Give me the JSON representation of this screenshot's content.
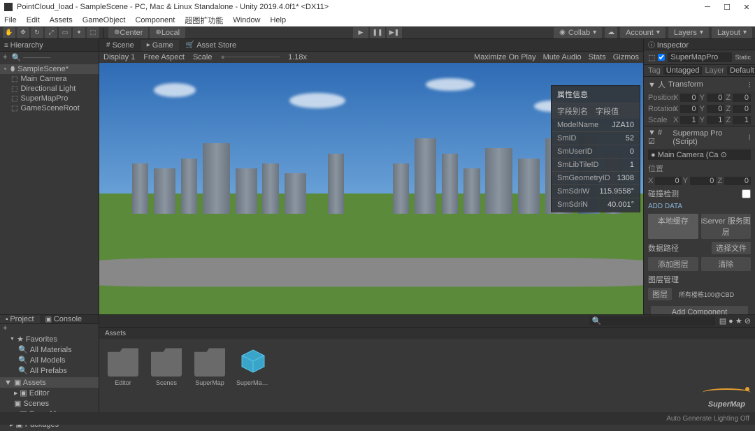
{
  "title": "PointCloud_load - SampleScene - PC, Mac & Linux Standalone - Unity 2019.4.0f1* <DX11>",
  "menu": [
    "File",
    "Edit",
    "Assets",
    "GameObject",
    "Component",
    "超图扩功能",
    "Window",
    "Help"
  ],
  "pivot": {
    "center": "Center",
    "local": "Local"
  },
  "toolbar_right": {
    "collab": "Collab",
    "account": "Account",
    "layers": "Layers",
    "layout": "Layout"
  },
  "hierarchy": {
    "tab": "Hierarchy",
    "create": "+",
    "scene": "SampleScene*",
    "items": [
      "Main Camera",
      "Directional Light",
      "SuperMapPro",
      "GameSceneRoot"
    ]
  },
  "gameview": {
    "tabs": {
      "scene": "Scene",
      "game": "Game",
      "asset_store": "Asset Store"
    },
    "display": "Display 1",
    "aspect": "Free Aspect",
    "scale_label": "Scale",
    "scale_value": "1.18x",
    "right_opts": [
      "Maximize On Play",
      "Mute Audio",
      "Stats",
      "Gizmos"
    ]
  },
  "attr": {
    "title": "属性信息",
    "col1": "字段别名",
    "col2": "字段值",
    "rows": [
      {
        "k": "ModelName",
        "v": "JZA10"
      },
      {
        "k": "SmID",
        "v": "52"
      },
      {
        "k": "SmUserID",
        "v": "0"
      },
      {
        "k": "SmLibTileID",
        "v": "1"
      },
      {
        "k": "SmGeometryID",
        "v": "1308"
      },
      {
        "k": "SmSdriW",
        "v": "115.9558°"
      },
      {
        "k": "SmSdriN",
        "v": "40.001°"
      }
    ]
  },
  "inspector": {
    "tab": "Inspector",
    "name": "SuperMapPro",
    "static": "Static",
    "tag_label": "Tag",
    "tag_value": "Untagged",
    "layer_label": "Layer",
    "layer_value": "Default",
    "transform": {
      "title": "Transform",
      "position": {
        "label": "Position",
        "x": "0",
        "y": "0",
        "z": "0"
      },
      "rotation": {
        "label": "Rotation",
        "x": "0",
        "y": "0",
        "z": "0"
      },
      "scale": {
        "label": "Scale",
        "x": "1",
        "y": "1",
        "z": "1"
      }
    },
    "script": {
      "title": "Supermap Pro (Script)",
      "main_camera": "Main Camera (Ca",
      "pos_label": "位置",
      "pos": {
        "x": "0",
        "y": "0",
        "z": "0"
      },
      "collision": "碰撞检测",
      "add_data": "ADD DATA",
      "tab1": "本地缓存",
      "tab2": "iServer 服务图层",
      "path_label": "数据路径",
      "browse": "选择文件",
      "add_layer": "添加图层",
      "clear": "清除",
      "layer_mgmt": "图层管理",
      "layers_list": "图层",
      "layer_item": "所有楼栋100@CBD"
    },
    "add_component": "Add Component"
  },
  "project": {
    "tabs": {
      "project": "Project",
      "console": "Console"
    },
    "favorites": "Favorites",
    "fav_items": [
      "All Materials",
      "All Models",
      "All Prefabs"
    ],
    "assets": "Assets",
    "asset_tree": [
      "Editor",
      "Scenes",
      "SuperMap"
    ],
    "packages": "Packages",
    "path": "Assets",
    "grid": [
      "Editor",
      "Scenes",
      "SuperMap",
      "SuperMap..."
    ]
  },
  "statusbar": "Auto Generate Lighting Off",
  "logo": "SuperMap"
}
